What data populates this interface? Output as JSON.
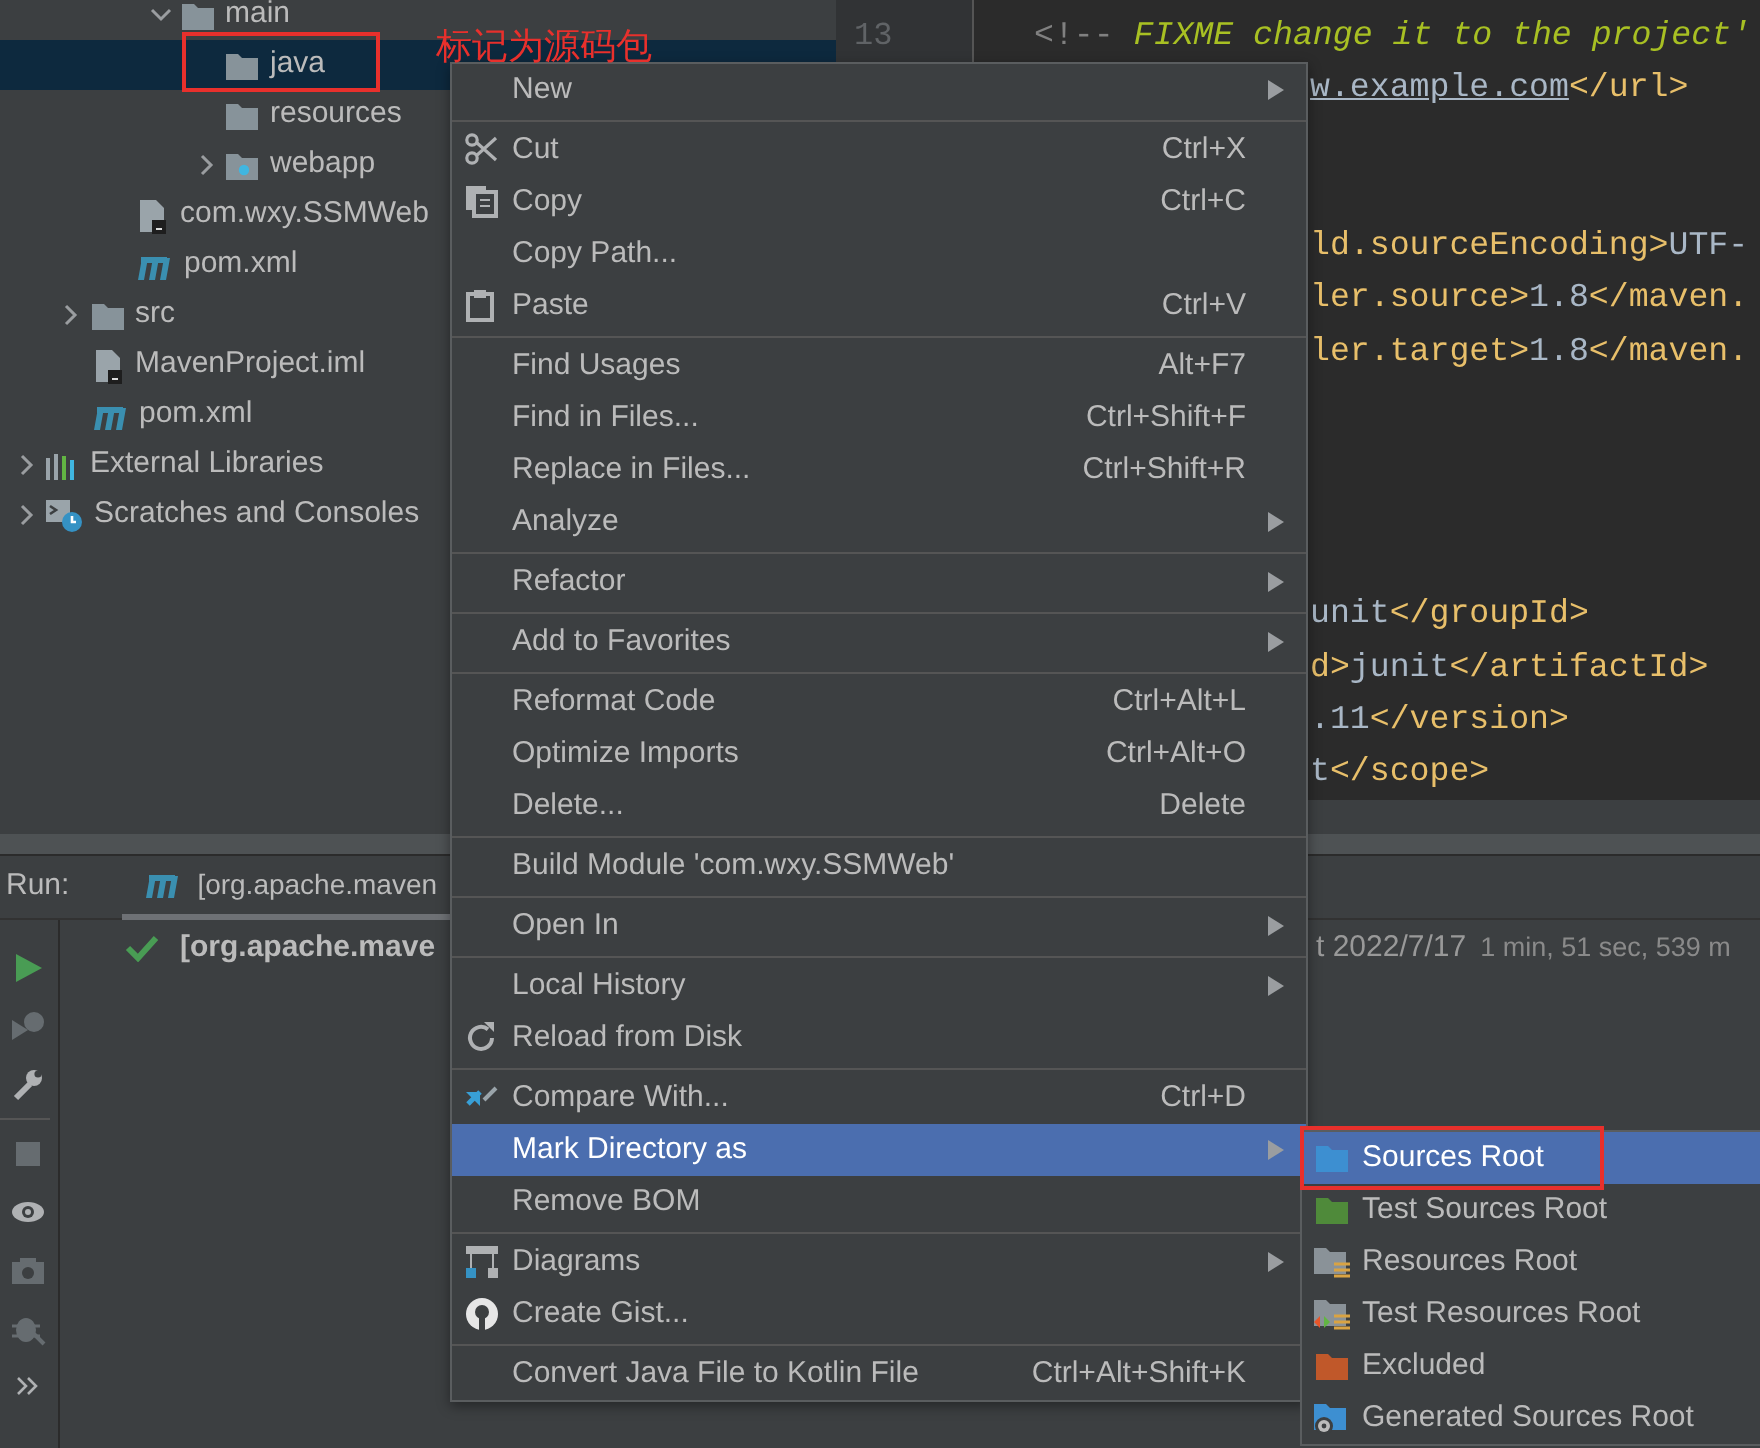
{
  "project_tree": [
    {
      "children": [
        {
          "children": [
            {
              "children": [
                {
                  "label": "main",
                  "kind": "folder",
                  "expanded": true,
                  "selected": false,
                  "annotated": false,
                  "children": [
                    {
                      "label": "java",
                      "kind": "folder",
                      "selected": true,
                      "annotated": true
                    },
                    {
                      "label": "resources",
                      "kind": "folder",
                      "selected": false,
                      "annotated": false
                    },
                    {
                      "label": "webapp",
                      "kind": "web-folder",
                      "expanded": false,
                      "selected": false,
                      "annotated": false
                    }
                  ]
                }
              ]
            },
            {
              "label": "com.wxy.SSMWeb",
              "kind": "module-file",
              "selected": false,
              "annotated": false
            },
            {
              "label": "pom.xml",
              "kind": "maven",
              "selected": false,
              "annotated": false
            }
          ]
        },
        {
          "label": "src",
          "kind": "folder",
          "expanded": false,
          "selected": false,
          "annotated": false
        },
        {
          "label": "MavenProject.iml",
          "kind": "module-file",
          "selected": false,
          "annotated": false
        },
        {
          "label": "pom.xml",
          "kind": "maven",
          "selected": false,
          "annotated": false
        }
      ]
    },
    {
      "label": "External Libraries",
      "kind": "libraries",
      "expanded": false,
      "selected": false,
      "annotated": false
    },
    {
      "label": "Scratches and Consoles",
      "kind": "scratches",
      "expanded": false,
      "selected": false,
      "annotated": false
    }
  ],
  "annotation": {
    "text": "标记为源码包"
  },
  "editor": {
    "code_blocks": [
      {
        "lines": [
          {
            "number": "13",
            "kind": "comment",
            "parts": [
              {
                "text": "<!-- ",
                "kind": "comment"
              },
              {
                "text": "FIXME change it to the project'",
                "kind": "todo"
              }
            ]
          },
          {
            "kind": "partial",
            "parts": [
              {
                "text": "w.example.com",
                "kind": "link"
              },
              {
                "text": "</url>",
                "kind": "tag"
              }
            ]
          }
        ]
      },
      {
        "lines": [
          {
            "kind": "partial",
            "parts": [
              {
                "text": "ld.sourceEncoding>",
                "kind": "tag"
              },
              {
                "text": "UTF-",
                "kind": "value"
              }
            ]
          },
          {
            "kind": "partial",
            "parts": [
              {
                "text": "ler.source>",
                "kind": "tag"
              },
              {
                "text": "1.8",
                "kind": "value"
              },
              {
                "text": "</maven.",
                "kind": "tag"
              }
            ]
          },
          {
            "kind": "partial",
            "parts": [
              {
                "text": "ler.target>",
                "kind": "tag"
              },
              {
                "text": "1.8",
                "kind": "value"
              },
              {
                "text": "</maven.",
                "kind": "tag"
              }
            ]
          }
        ]
      },
      {
        "lines": [
          {
            "kind": "partial",
            "parts": [
              {
                "text": "unit",
                "kind": "value"
              },
              {
                "text": "</groupId>",
                "kind": "tag"
              }
            ]
          },
          {
            "kind": "partial",
            "parts": [
              {
                "text": "d>",
                "kind": "tag"
              },
              {
                "text": "junit",
                "kind": "value"
              },
              {
                "text": "</artifactId>",
                "kind": "tag"
              }
            ]
          },
          {
            "kind": "partial",
            "parts": [
              {
                "text": ".11",
                "kind": "value"
              },
              {
                "text": "</version>",
                "kind": "tag"
              }
            ]
          },
          {
            "kind": "partial",
            "parts": [
              {
                "text": "t",
                "kind": "value"
              },
              {
                "text": "</scope>",
                "kind": "tag"
              }
            ]
          }
        ]
      }
    ]
  },
  "run_panel": {
    "label": "Run:",
    "tabs": [
      {
        "label": "[org.apache.maven",
        "selected": true
      }
    ],
    "toolbar": [
      {
        "kind": "run",
        "disabled": false
      },
      {
        "kind": "rerun-debug",
        "disabled": true
      },
      {
        "kind": "settings",
        "disabled": false
      },
      {
        "kind": "separator"
      },
      {
        "kind": "stop",
        "disabled": true
      },
      {
        "kind": "view",
        "disabled": false
      },
      {
        "kind": "camera",
        "disabled": true
      },
      {
        "kind": "bug",
        "disabled": true
      },
      {
        "kind": "more",
        "disabled": false
      }
    ],
    "results": [
      {
        "label": "[org.apache.mave",
        "date": "t 2022/7/17",
        "duration": "1 min, 51 sec, 539 m"
      }
    ]
  },
  "context_menu": {
    "items": [
      {
        "kind": "item",
        "label": "New",
        "submenu": true,
        "selected": false
      },
      {
        "kind": "separator"
      },
      {
        "kind": "item",
        "label": "Cut",
        "shortcut": "Ctrl+X",
        "selected": false
      },
      {
        "kind": "item",
        "label": "Copy",
        "shortcut": "Ctrl+C",
        "selected": false
      },
      {
        "kind": "item",
        "label": "Copy Path...",
        "selected": false
      },
      {
        "kind": "item",
        "label": "Paste",
        "shortcut": "Ctrl+V",
        "selected": false
      },
      {
        "kind": "separator"
      },
      {
        "kind": "item",
        "label": "Find Usages",
        "shortcut": "Alt+F7",
        "selected": false
      },
      {
        "kind": "item",
        "label": "Find in Files...",
        "shortcut": "Ctrl+Shift+F",
        "selected": false
      },
      {
        "kind": "item",
        "label": "Replace in Files...",
        "shortcut": "Ctrl+Shift+R",
        "selected": false
      },
      {
        "kind": "item",
        "label": "Analyze",
        "submenu": true,
        "selected": false
      },
      {
        "kind": "separator"
      },
      {
        "kind": "item",
        "label": "Refactor",
        "submenu": true,
        "selected": false
      },
      {
        "kind": "separator"
      },
      {
        "kind": "item",
        "label": "Add to Favorites",
        "submenu": true,
        "selected": false
      },
      {
        "kind": "separator"
      },
      {
        "kind": "item",
        "label": "Reformat Code",
        "shortcut": "Ctrl+Alt+L",
        "selected": false
      },
      {
        "kind": "item",
        "label": "Optimize Imports",
        "shortcut": "Ctrl+Alt+O",
        "selected": false
      },
      {
        "kind": "item",
        "label": "Delete...",
        "shortcut": "Delete",
        "selected": false
      },
      {
        "kind": "separator"
      },
      {
        "kind": "item",
        "label": "Build Module 'com.wxy.SSMWeb'",
        "selected": false
      },
      {
        "kind": "separator"
      },
      {
        "kind": "item",
        "label": "Open In",
        "submenu": true,
        "selected": false
      },
      {
        "kind": "separator"
      },
      {
        "kind": "item",
        "label": "Local History",
        "submenu": true,
        "selected": false
      },
      {
        "kind": "item",
        "label": "Reload from Disk",
        "selected": false
      },
      {
        "kind": "separator"
      },
      {
        "kind": "item",
        "label": "Compare With...",
        "shortcut": "Ctrl+D",
        "selected": false
      },
      {
        "kind": "item",
        "label": "Mark Directory as",
        "submenu": true,
        "selected": true
      },
      {
        "kind": "item",
        "label": "Remove BOM",
        "selected": false
      },
      {
        "kind": "separator"
      },
      {
        "kind": "item",
        "label": "Diagrams",
        "submenu": true,
        "selected": false
      },
      {
        "kind": "item",
        "label": "Create Gist...",
        "selected": false
      },
      {
        "kind": "separator"
      },
      {
        "kind": "item",
        "label": "Convert Java File to Kotlin File",
        "shortcut": "Ctrl+Alt+Shift+K",
        "selected": false
      }
    ]
  },
  "submenu": {
    "items": [
      {
        "label": "Sources Root",
        "kind": "folder",
        "color": "#3d8fd1",
        "selected": true,
        "annotated": true
      },
      {
        "label": "Test Sources Root",
        "kind": "folder",
        "color": "#4f8a3a",
        "selected": false,
        "annotated": false
      },
      {
        "label": "Resources Root",
        "kind": "resources-folder",
        "color": "#8a9298",
        "selected": false,
        "annotated": false
      },
      {
        "label": "Test Resources Root",
        "kind": "test-resources-folder",
        "color": "#8a9298",
        "selected": false,
        "annotated": false
      },
      {
        "label": "Excluded",
        "kind": "folder",
        "color": "#c0582a",
        "selected": false,
        "annotated": false
      },
      {
        "label": "Generated Sources Root",
        "kind": "generated-folder",
        "color": "#3d8fd1",
        "selected": false,
        "annotated": false
      }
    ]
  }
}
